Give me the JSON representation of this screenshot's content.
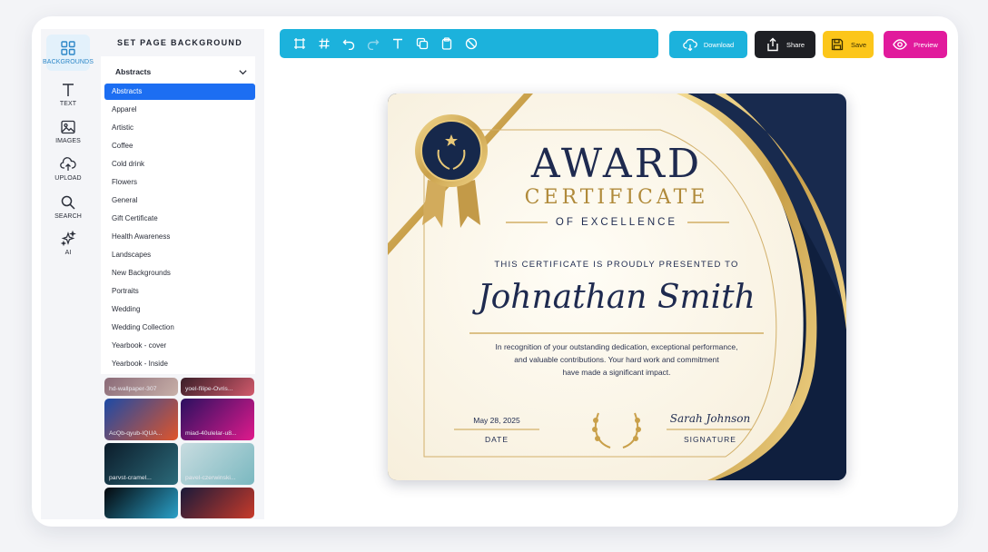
{
  "sidebar": {
    "items": [
      {
        "label": "BACKGROUNDS",
        "icon": "grid-icon",
        "active": true
      },
      {
        "label": "TEXT",
        "icon": "text-icon"
      },
      {
        "label": "IMAGES",
        "icon": "image-icon"
      },
      {
        "label": "UPLOAD",
        "icon": "upload-icon"
      },
      {
        "label": "SEARCH",
        "icon": "search-icon"
      },
      {
        "label": "AI",
        "icon": "sparkle-icon"
      }
    ]
  },
  "panel": {
    "title": "SET PAGE BACKGROUND",
    "dropdown_value": "Abstracts",
    "categories": [
      "Abstracts",
      "Apparel",
      "Artistic",
      "Coffee",
      "Cold drink",
      "Flowers",
      "General",
      "Gift Certificate",
      "Health Awareness",
      "Landscapes",
      "New Backgrounds",
      "Portraits",
      "Wedding",
      "Wedding Collection",
      "Yearbook - cover",
      "Yearbook - Inside"
    ],
    "selected_category": "Abstracts",
    "thumbnails": [
      {
        "label": "hd-wallpaper-307",
        "colors": [
          "#8a6a78",
          "#c8b0a8"
        ]
      },
      {
        "label": "yoel-filipe-Ovris...",
        "colors": [
          "#3a1e28",
          "#d25a6c"
        ]
      },
      {
        "label": "AcQb-qyub-IQUA...",
        "colors": [
          "#1c4aa6",
          "#e0552a"
        ]
      },
      {
        "label": "miad-40ulelar-u8...",
        "colors": [
          "#2a1060",
          "#e01a8c"
        ]
      },
      {
        "label": "parvst-cramel...",
        "colors": [
          "#0c1c2a",
          "#2b6a7a"
        ]
      },
      {
        "label": "pavel-czerwinski...",
        "colors": [
          "#c8dce0",
          "#7ab8c0"
        ]
      },
      {
        "label": "",
        "colors": [
          "#05080c",
          "#2aa0c8"
        ]
      },
      {
        "label": "",
        "colors": [
          "#1a1a3a",
          "#c83a2a"
        ]
      }
    ]
  },
  "toolbar": {
    "tools": [
      {
        "icon": "frame-icon"
      },
      {
        "icon": "hash-icon"
      },
      {
        "icon": "undo-icon"
      },
      {
        "icon": "redo-icon"
      },
      {
        "icon": "text-tool-icon"
      },
      {
        "icon": "copy-icon"
      },
      {
        "icon": "clipboard-icon"
      },
      {
        "icon": "hide-icon"
      }
    ]
  },
  "actions": {
    "download": "Download",
    "share": "Share",
    "save": "Save",
    "preview": "Preview"
  },
  "certificate": {
    "title_main": "AWARD",
    "title_sub": "CERTIFICATE",
    "title_line": "OF EXCELLENCE",
    "presented": "THIS CERTIFICATE IS PROUDLY PRESENTED TO",
    "recipient": "Johnathan Smith",
    "body_lines": [
      "In recognition of your outstanding dedication, exceptional performance,",
      "and valuable contributions. Your hard work and commitment",
      "have made a significant impact."
    ],
    "date_value": "May 28, 2025",
    "date_label": "DATE",
    "signature_value": "Sarah Johnson",
    "signature_label": "SIGNATURE"
  },
  "colors": {
    "accent_cyan": "#1cb2dc",
    "share_black": "#1e1f24",
    "save_yellow": "#fcc61a",
    "preview_magenta": "#e11a9c",
    "selected_blue": "#1c6ef2",
    "navy": "#1e2a4f",
    "gold": "#c9a04a"
  }
}
